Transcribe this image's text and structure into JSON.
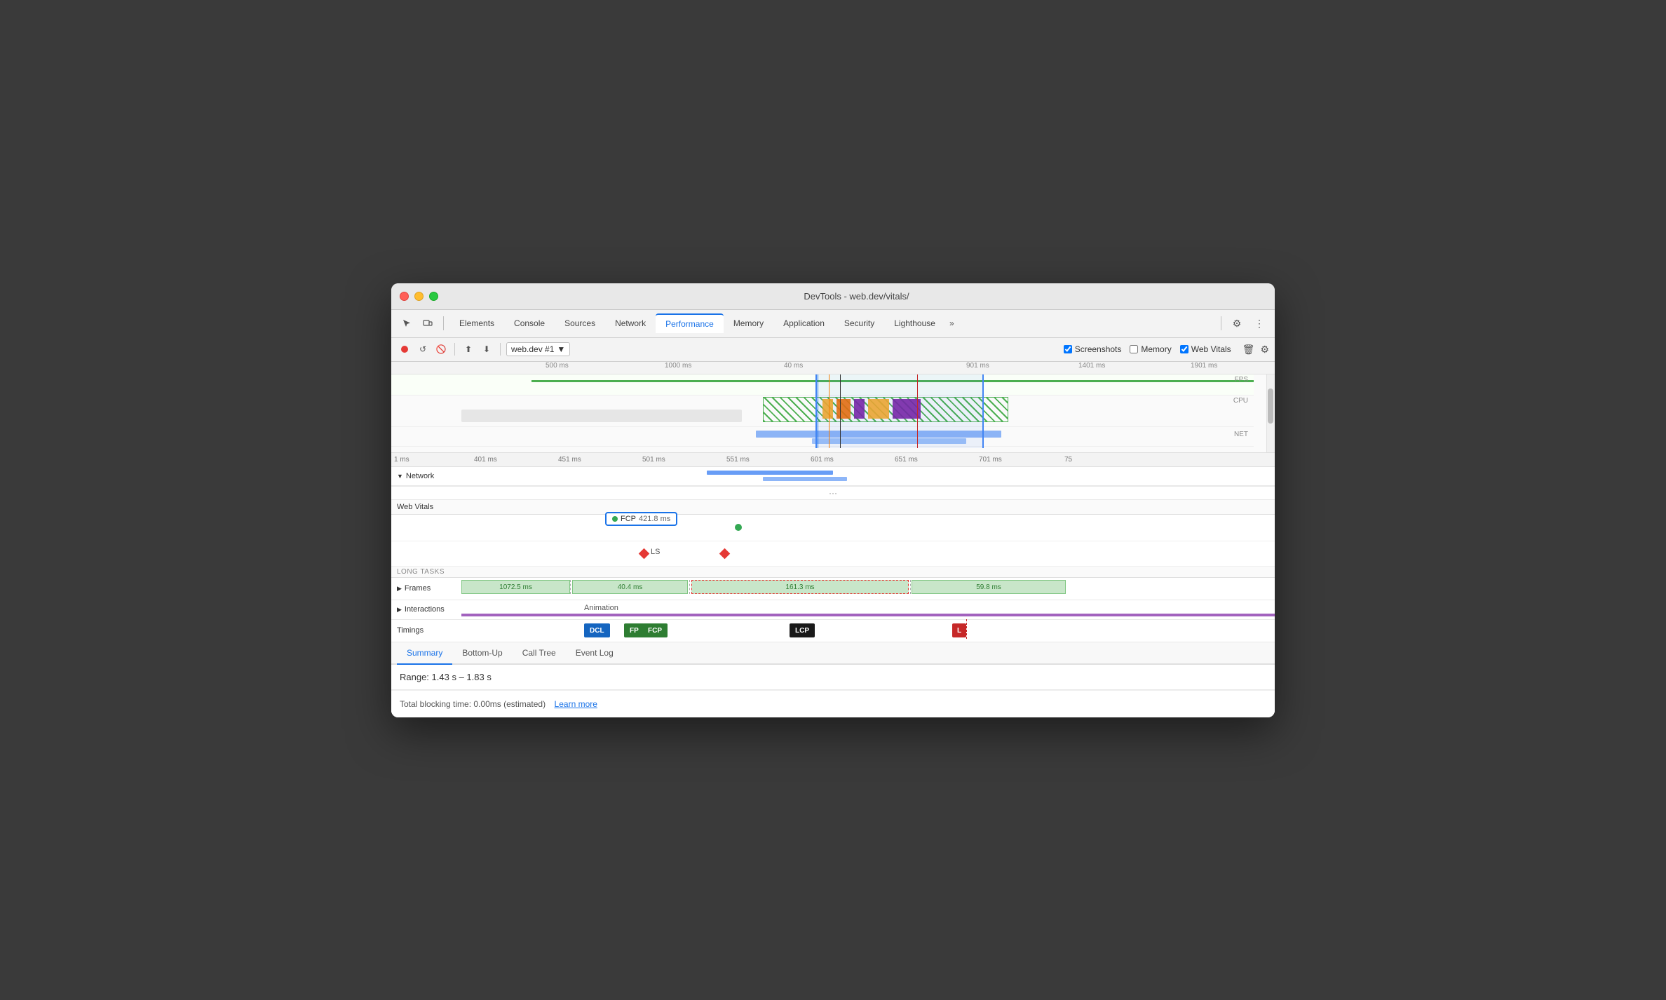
{
  "window": {
    "title": "DevTools - web.dev/vitals/",
    "traffic_lights": [
      "red",
      "yellow",
      "green"
    ]
  },
  "nav": {
    "tabs": [
      {
        "label": "Elements",
        "active": false
      },
      {
        "label": "Console",
        "active": false
      },
      {
        "label": "Sources",
        "active": false
      },
      {
        "label": "Network",
        "active": false
      },
      {
        "label": "Performance",
        "active": true
      },
      {
        "label": "Memory",
        "active": false
      },
      {
        "label": "Application",
        "active": false
      },
      {
        "label": "Security",
        "active": false
      },
      {
        "label": "Lighthouse",
        "active": false
      }
    ],
    "more_label": "»"
  },
  "toolbar": {
    "session": "web.dev #1",
    "screenshots_label": "Screenshots",
    "memory_label": "Memory",
    "web_vitals_label": "Web Vitals"
  },
  "timeline_ruler": {
    "marks": [
      "500 ms",
      "1000 ms",
      "40 ms",
      "901 ms",
      "1401 ms",
      "1901 ms"
    ]
  },
  "detail_ruler": {
    "marks": [
      "1 ms",
      "401 ms",
      "451 ms",
      "501 ms",
      "551 ms",
      "601 ms",
      "651 ms",
      "701 ms",
      "75"
    ]
  },
  "sections": {
    "network_label": "Network",
    "web_vitals_label": "Web Vitals",
    "long_tasks_label": "LONG TASKS",
    "frames_label": "Frames",
    "interactions_label": "Interactions",
    "timings_label": "Timings"
  },
  "web_vitals": {
    "fcp_label": "FCP",
    "fcp_value": "421.8 ms",
    "ls_label": "LS"
  },
  "frames": [
    {
      "label": "1072.5 ms",
      "width_pct": 19
    },
    {
      "label": "40.4 ms",
      "width_pct": 22
    },
    {
      "label": "161.3 ms",
      "width_pct": 32
    },
    {
      "label": "59.8 ms",
      "width_pct": 18
    }
  ],
  "interactions": {
    "label": "Animation"
  },
  "timings": {
    "dcl": "DCL",
    "fp": "FP",
    "fcp": "FCP",
    "lcp": "LCP",
    "l": "L"
  },
  "bottom_tabs": [
    "Summary",
    "Bottom-Up",
    "Call Tree",
    "Event Log"
  ],
  "summary": {
    "range_label": "Range:",
    "range_value": "1.43 s – 1.83 s",
    "blocking_label": "Total blocking time: 0.00ms (estimated)",
    "learn_more": "Learn more"
  }
}
